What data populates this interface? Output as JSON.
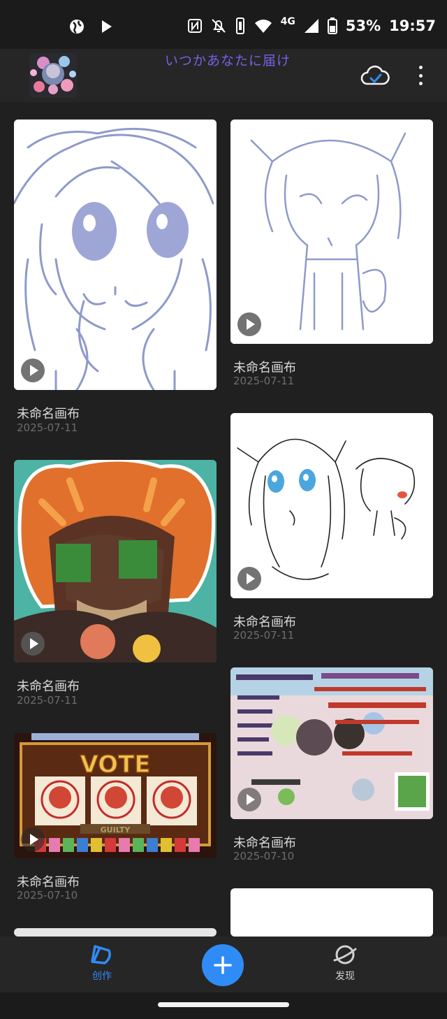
{
  "status_bar": {
    "time": "19:57",
    "battery_percent": "53%",
    "network": "4G",
    "left_icons": [
      "globe-icon",
      "play-store-icon"
    ],
    "right_icons": [
      "nfc-icon",
      "mute-icon",
      "vibrate-icon",
      "wifi-icon",
      "signal-icon",
      "battery-icon"
    ]
  },
  "header": {
    "title": "いつかあなたに届け",
    "title_color": "#7a5fe8",
    "sync_icon": "cloud-check-icon",
    "menu_icon": "more-vert-icon"
  },
  "artworks": [
    {
      "title": "未命名画布",
      "date": "2025-07-11",
      "thumbnail": "sketch-girl-closeup"
    },
    {
      "title": "未命名画布",
      "date": "2025-07-11",
      "thumbnail": "sketch-chibi-full-body"
    },
    {
      "title": "未命名画布",
      "date": "2025-07-11",
      "thumbnail": "tiger-hood-character"
    },
    {
      "title": "未命名画布",
      "date": "2025-07-11",
      "thumbnail": "lineart-two-characters"
    },
    {
      "title": "未命名画布",
      "date": "2025-07-10",
      "thumbnail": "vote-slot-machine"
    },
    {
      "title": "未命名画布",
      "date": "2025-07-10",
      "thumbnail": "collage-poster"
    }
  ],
  "vote_text": "VOTE",
  "guilty_text": "GUILTY",
  "bottom_nav": {
    "create_label": "创作",
    "discover_label": "发现",
    "active_color": "#2f8cf6",
    "fab_icon": "plus-icon"
  }
}
